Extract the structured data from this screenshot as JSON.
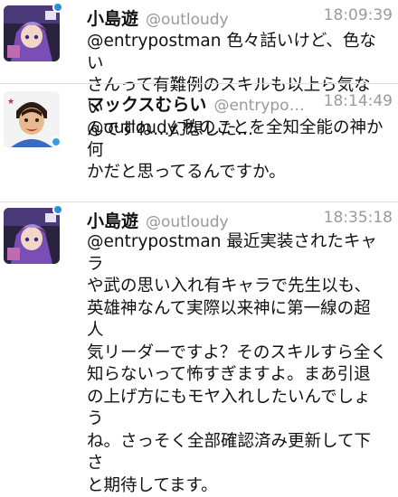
{
  "tweets": [
    {
      "name": "小島遊",
      "handle": "@outloudy",
      "time": "18:09:39",
      "text": "@entrypostman 色々話いけど、色ない\nさんって有難例のスキルも以上ら気ない\nんですね…幻想した…"
    },
    {
      "name": "マックスむらい",
      "handle": "@entrypo…",
      "time": "18:14:49",
      "text": "@outloudy 私のことを全知全能の神か何\nかだと思ってるんですか。"
    },
    {
      "name": "小島遊",
      "handle": "@outloudy",
      "time": "18:35:18",
      "text": "@entrypostman 最近実装されたキャラ\nや武の思い入れ有キャラで先生以も、\n英雄神なんて実際以来神に第一線の超人\n気リーダーですよ？そのスキルすら全く\n知らないって怖すぎますよ。まあ引退\nの上げ方にもモヤ入れしたいんでしょう\nね。さっそく全部確認済み更新して下さ\nと期待してます。"
    }
  ]
}
